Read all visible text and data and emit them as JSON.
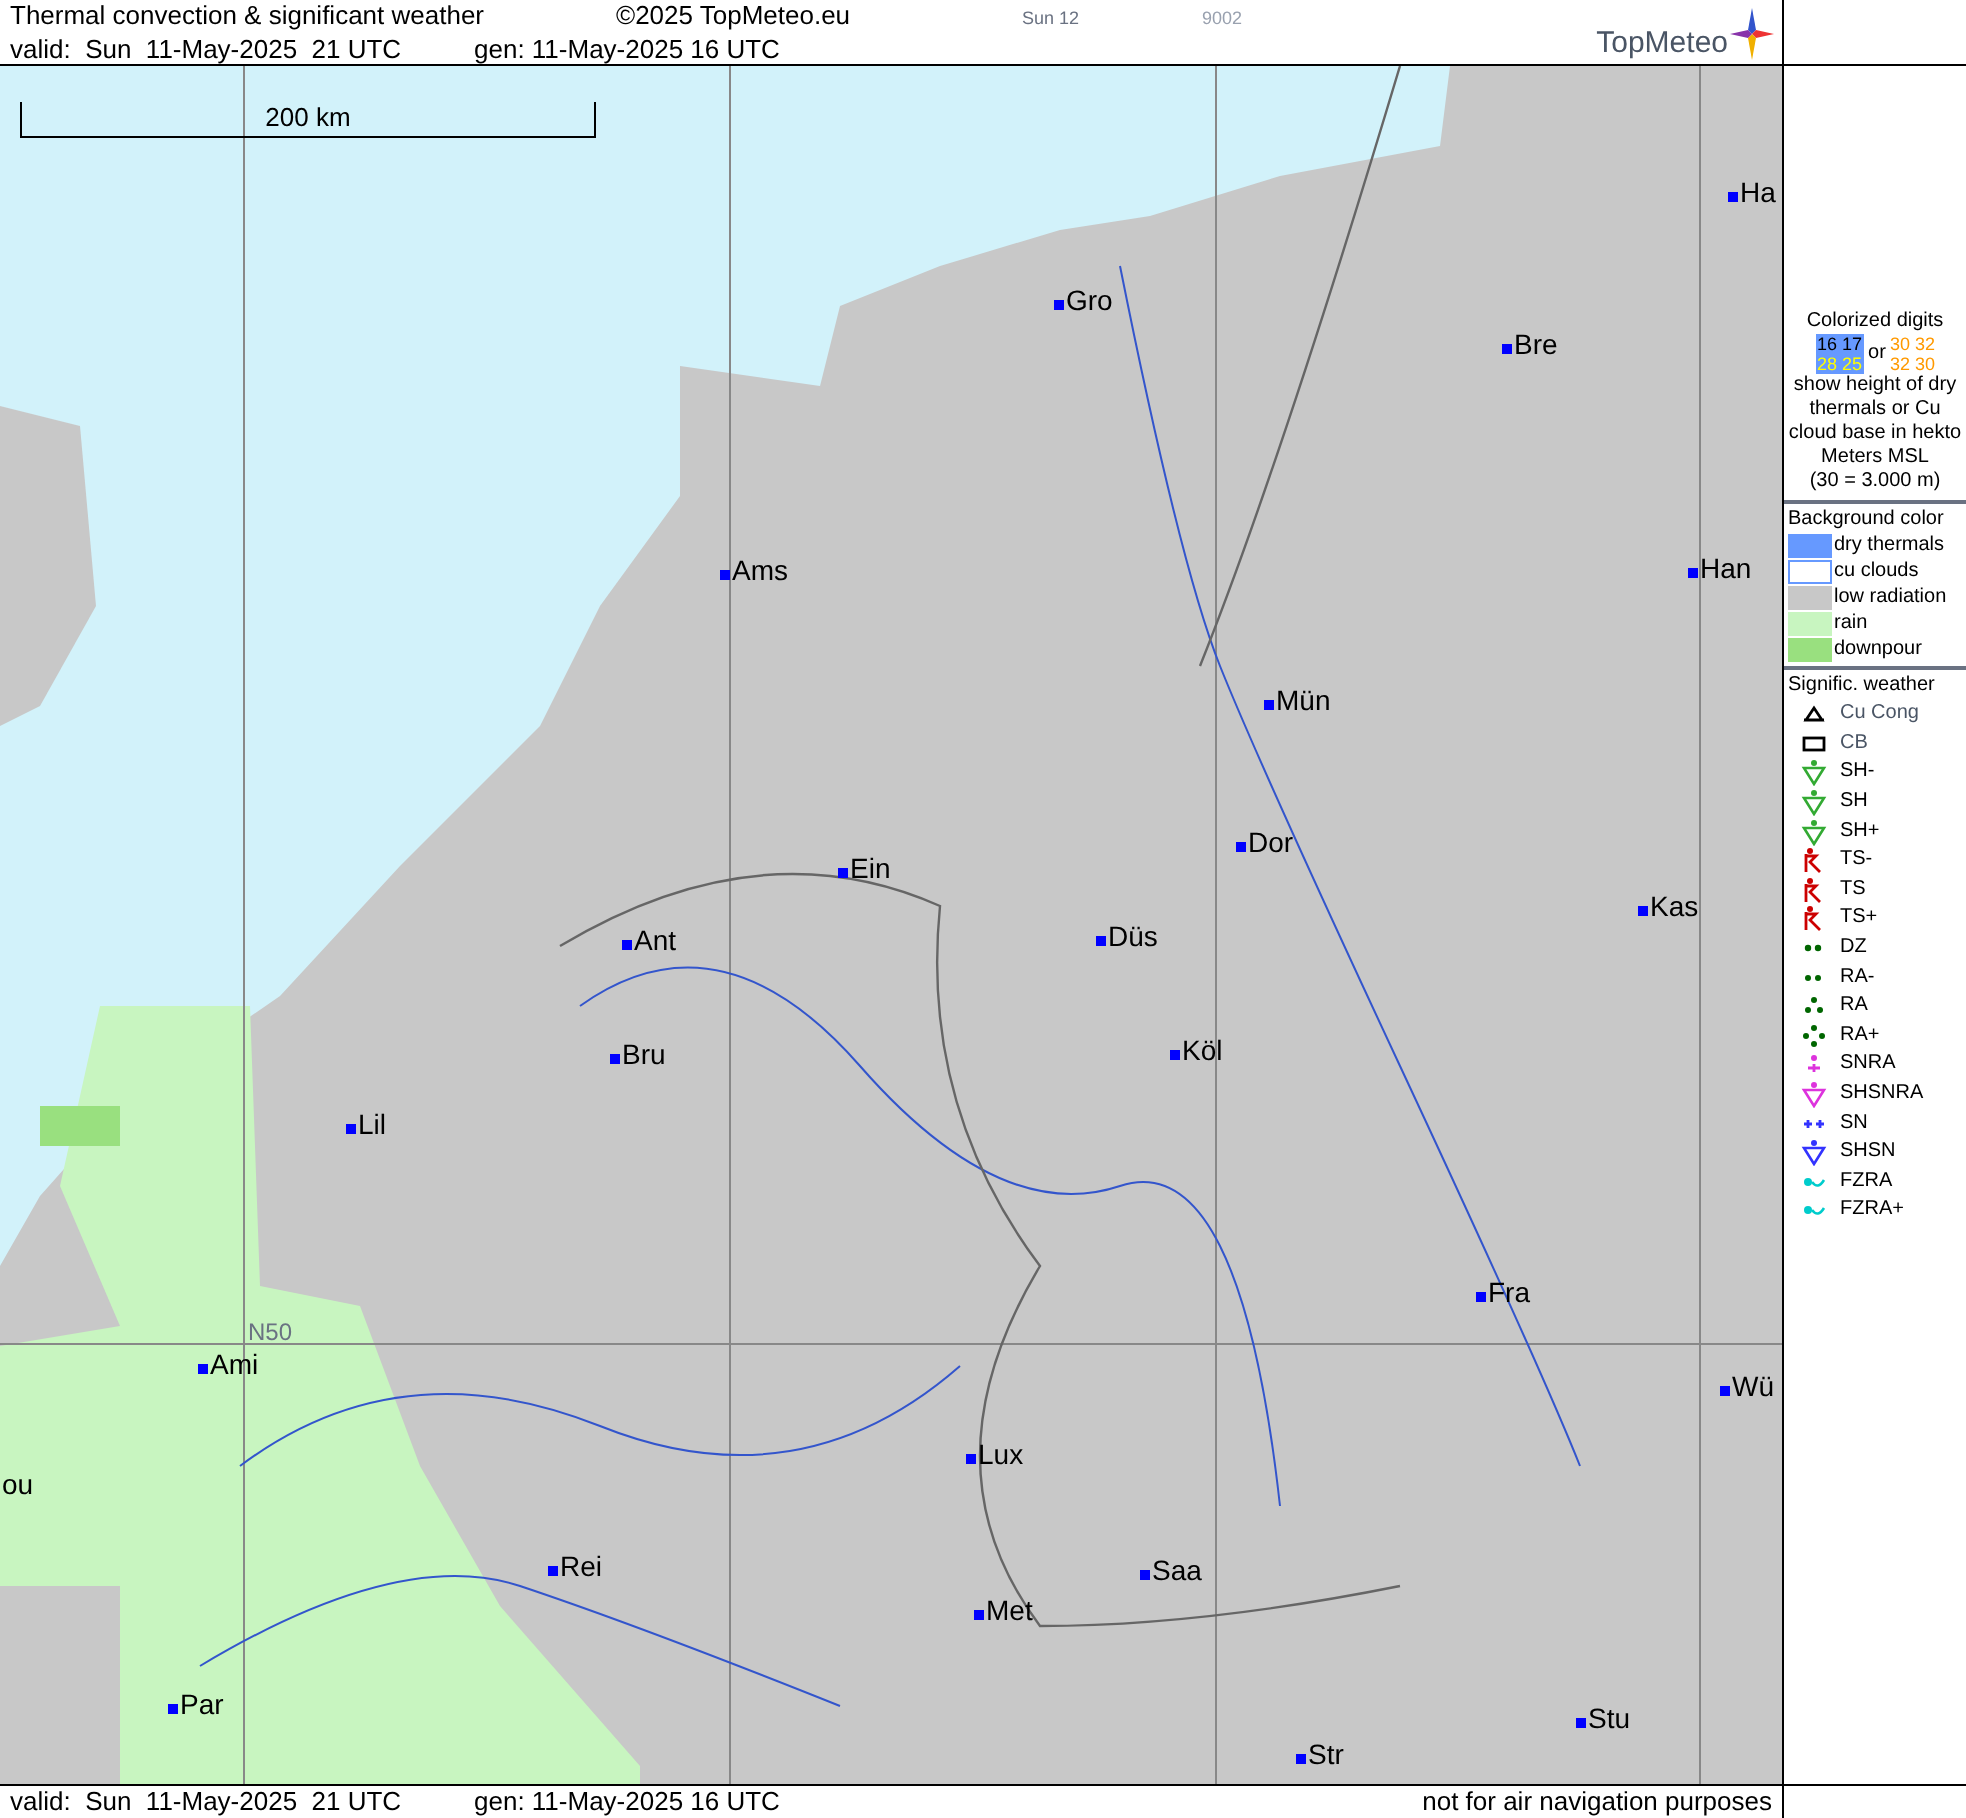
{
  "header": {
    "title": "Thermal convection & significant weather",
    "copyright": "©2025 TopMeteo.eu",
    "day": "Sun 12",
    "code": "9002",
    "valid": "valid:  Sun  11-May-2025  21 UTC",
    "generated": "gen: 11-May-2025 16 UTC",
    "logo": "TopMeteo"
  },
  "map": {
    "scale": "200 km",
    "grid_label": "N50",
    "cities": [
      {
        "name": "Ha"
      },
      {
        "name": "Gro"
      },
      {
        "name": "Bre"
      },
      {
        "name": "Ams"
      },
      {
        "name": "Han"
      },
      {
        "name": "Mün"
      },
      {
        "name": "Dor"
      },
      {
        "name": "Ein"
      },
      {
        "name": "Kas"
      },
      {
        "name": "Düs"
      },
      {
        "name": "Ant"
      },
      {
        "name": "Köl"
      },
      {
        "name": "Bru"
      },
      {
        "name": "Lil"
      },
      {
        "name": "Fra"
      },
      {
        "name": "Ami"
      },
      {
        "name": "Wü"
      },
      {
        "name": "Lux"
      },
      {
        "name": "ou"
      },
      {
        "name": "Rei"
      },
      {
        "name": "Saa"
      },
      {
        "name": "Met"
      },
      {
        "name": "Par"
      },
      {
        "name": "Stu"
      },
      {
        "name": "Str"
      }
    ]
  },
  "legend": {
    "digits_title": "Colorized digits",
    "digits_blue": [
      "16 17",
      "28 25"
    ],
    "digits_or": "or",
    "digits_orange": [
      "30 32",
      "32 30"
    ],
    "digits_text": "show height of dry thermals or Cu cloud base in hekto Meters MSL",
    "digits_example": "(30 = 3.000 m)",
    "background_title": "Background color",
    "backgrounds": [
      {
        "label": "dry thermals",
        "color": "#6699ff",
        "kind": "fill"
      },
      {
        "label": "cu clouds",
        "color": "#6699ff",
        "kind": "outline"
      },
      {
        "label": "low radiation",
        "color": "#c8c8c8",
        "kind": "fill"
      },
      {
        "label": "rain",
        "color": "#c8f5c0",
        "kind": "fill"
      },
      {
        "label": "downpour",
        "color": "#99e07f",
        "kind": "fill"
      }
    ],
    "weather_title": "Signific. weather",
    "weather": [
      {
        "label": "Cu Cong",
        "kind": "cucong",
        "color": "#000000"
      },
      {
        "label": "CB",
        "kind": "cb",
        "color": "#000000"
      },
      {
        "label": "SH-",
        "kind": "shower",
        "color": "#33aa33"
      },
      {
        "label": "SH",
        "kind": "shower",
        "color": "#33aa33"
      },
      {
        "label": "SH+",
        "kind": "shower",
        "color": "#33aa33"
      },
      {
        "label": "TS-",
        "kind": "thunder",
        "color": "#cc0000"
      },
      {
        "label": "TS",
        "kind": "thunder",
        "color": "#cc0000"
      },
      {
        "label": "TS+",
        "kind": "thunder",
        "color": "#cc0000"
      },
      {
        "label": "DZ",
        "kind": "drizzle",
        "color": "#006600"
      },
      {
        "label": "RA-",
        "kind": "dots2",
        "color": "#006600"
      },
      {
        "label": "RA",
        "kind": "dots3",
        "color": "#006600"
      },
      {
        "label": "RA+",
        "kind": "dots4",
        "color": "#006600"
      },
      {
        "label": "SNRA",
        "kind": "snra",
        "color": "#dd33dd"
      },
      {
        "label": "SHSNRA",
        "kind": "shower",
        "color": "#dd33dd"
      },
      {
        "label": "SN",
        "kind": "snow",
        "color": "#3333ff"
      },
      {
        "label": "SHSN",
        "kind": "shower",
        "color": "#3333ff"
      },
      {
        "label": "FZRA",
        "kind": "fzra",
        "color": "#00cccc"
      },
      {
        "label": "FZRA+",
        "kind": "fzra",
        "color": "#00cccc"
      }
    ]
  },
  "footer": {
    "valid": "valid:  Sun  11-May-2025  21 UTC",
    "generated": "gen: 11-May-2025 16 UTC",
    "note": "not for air navigation purposes"
  }
}
